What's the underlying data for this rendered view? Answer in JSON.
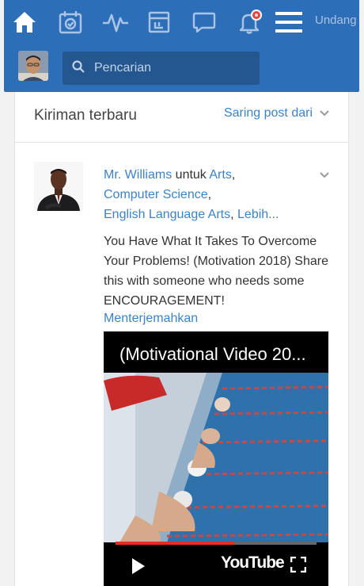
{
  "nav": {
    "icons": [
      "home-icon",
      "planner-icon",
      "activity-icon",
      "backpack-icon",
      "messages-icon",
      "notifications-icon",
      "menu-icon"
    ],
    "invite_label": "Undang"
  },
  "search": {
    "placeholder": "Pencarian"
  },
  "feed": {
    "title": "Kiriman terbaru",
    "filter_label": "Saring post dari"
  },
  "post": {
    "author": "Mr. Williams",
    "connector": " untuk ",
    "groups": [
      "Arts",
      "Computer Science",
      "English Language Arts"
    ],
    "more_label": "Lebih...",
    "text": "You Have What It Takes To Overcome Your Problems! (Motivation 2018) Share this with someone who needs some ENCOURAGEMENT!",
    "translate_label": "Menterjemahkan",
    "video": {
      "title": "(Motivational Video 20...",
      "provider": "YouTube",
      "progress": 0.59
    }
  },
  "colors": {
    "nav_bg": "#2d6eb9",
    "link": "#3d82c7",
    "badge": "#e64141"
  }
}
